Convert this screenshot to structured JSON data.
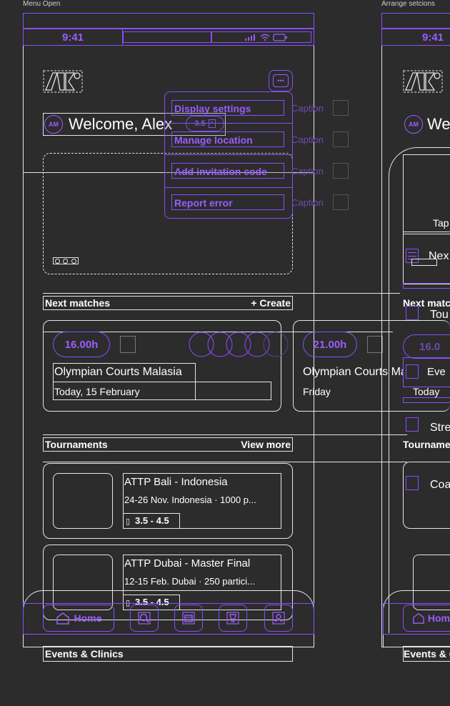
{
  "frames": {
    "left_label": "Menu Open",
    "right_label": "Arrange setcions"
  },
  "status_bar": {
    "time": "9:41"
  },
  "header": {
    "avatar_initials": "AM",
    "welcome": "Welcome, Alex",
    "level": "3.5"
  },
  "menu": {
    "items": [
      {
        "label": "Display settings",
        "caption": "Caption"
      },
      {
        "label": "Manage location",
        "caption": "Caption"
      },
      {
        "label": "Add invitation code",
        "caption": "Caption"
      },
      {
        "label": "Report error",
        "caption": "Caption"
      }
    ]
  },
  "next_matches": {
    "title": "Next matches",
    "action": "+ Create",
    "cards": [
      {
        "time": "16.00h",
        "venue": "Olympian Courts Malasia",
        "date": "Today, 15 February"
      },
      {
        "time": "21.00h",
        "venue": "Olympian Courts Malasia",
        "date": "Friday"
      }
    ]
  },
  "tournaments": {
    "title": "Tournaments",
    "action": "View more",
    "items": [
      {
        "name": "ATTP Bali - Indonesia",
        "details": "24-26 Nov. Indonesia · 1000 p...",
        "level": "3.5 - 4.5"
      },
      {
        "name": "ATTP Dubai - Master Final",
        "details": "12-15 Feb. Dubai · 250 partici...",
        "level": "3.5 - 4.5"
      }
    ]
  },
  "events": {
    "title": "Events & Clinics"
  },
  "nav": {
    "home": "Home"
  },
  "arrange": {
    "status_time": "9:41",
    "welcome_partial": "We",
    "tap_partial": "Tap",
    "sections": [
      "Nex",
      "Tou",
      "Eve",
      "Stre",
      "Coa"
    ],
    "tournaments_partial": "Tourname",
    "next_partial": "Next matc",
    "match_time_partial": "16.0",
    "today_partial": "Today",
    "events_partial": "Events & C",
    "home_partial": "Hom"
  }
}
